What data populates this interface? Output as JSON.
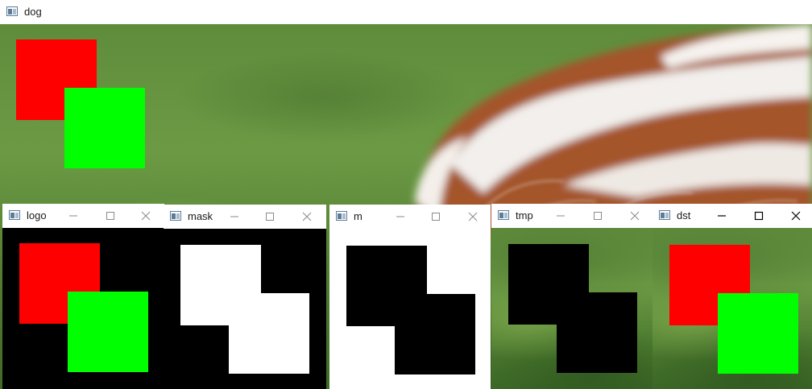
{
  "colors": {
    "red": "#ff0000",
    "green": "#00ff00",
    "black": "#000000",
    "white": "#ffffff",
    "fur_brown": "#a4552b"
  },
  "windows": {
    "dog": {
      "title": "dog",
      "icon": "opencv-window-icon"
    },
    "logo": {
      "title": "logo",
      "icon": "opencv-window-icon"
    },
    "mask": {
      "title": "mask",
      "icon": "opencv-window-icon"
    },
    "m": {
      "title": "m",
      "icon": "opencv-window-icon"
    },
    "tmp": {
      "title": "tmp",
      "icon": "opencv-window-icon"
    },
    "dst": {
      "title": "dst",
      "icon": "opencv-window-icon"
    }
  },
  "controls": [
    "minimize-icon",
    "maximize-icon",
    "close-icon"
  ]
}
